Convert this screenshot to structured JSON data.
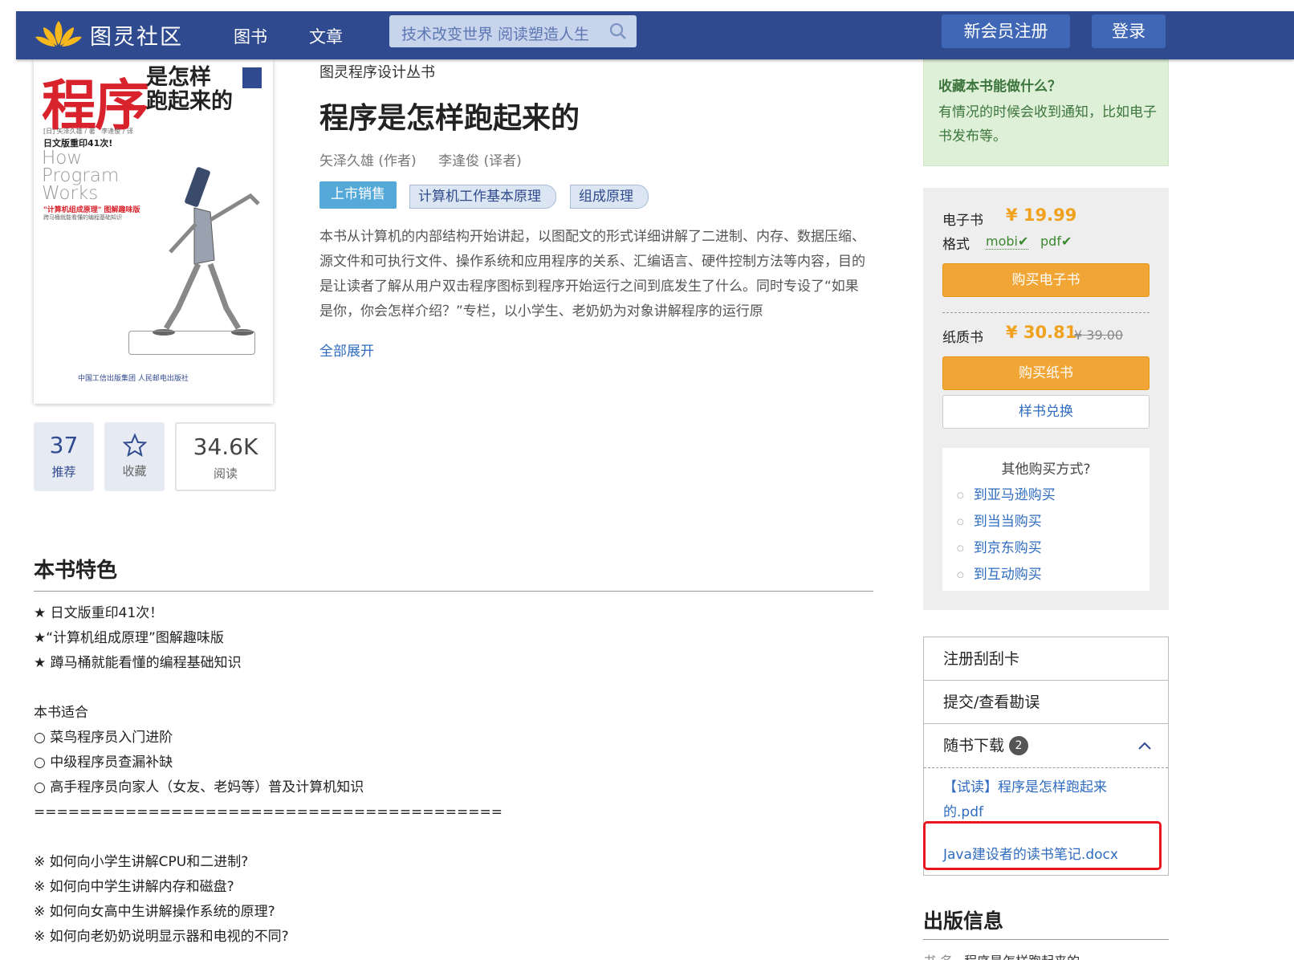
{
  "header": {
    "site_name": "图灵社区",
    "nav": [
      "图书",
      "文章"
    ],
    "search_placeholder": "技术改变世界 阅读塑造人生",
    "register_label": "新会员注册",
    "login_label": "登录",
    "brand_color": "#2f4a8e"
  },
  "cover": {
    "title_big": "程序",
    "title_rest": "是怎样跑起来的",
    "reprint": "日文版重印41次!",
    "english_title": "How Program Works",
    "tagline": "\"计算机组成原理\" 图解趣味版",
    "publisher": "中国工信出版集团  人民邮电出版社"
  },
  "stats": {
    "recommend_count": "37",
    "recommend_label": "推荐",
    "favorite_label": "收藏",
    "read_count": "34.6K",
    "read_label": "阅读"
  },
  "book": {
    "series": "图灵程序设计丛书",
    "title": "程序是怎样跑起来的",
    "author": "矢泽久雄 (作者)",
    "translator": "李逢俊 (译者)",
    "status_tag": "上市销售",
    "tags": [
      "计算机工作基本原理",
      "组成原理"
    ],
    "description": "本书从计算机的内部结构开始讲起，以图配文的形式详细讲解了二进制、内存、数据压缩、源文件和可执行文件、操作系统和应用程序的关系、汇编语言、硬件控制方法等内容，目的是让读者了解从用户双击程序图标到程序开始运行之间到底发生了什么。同时专设了“如果是你，你会怎样介绍？”专栏，以小学生、老奶奶为对象讲解程序的运行原",
    "expand_label": "全部展开"
  },
  "features": {
    "title": "本书特色",
    "lines": [
      "★ 日文版重印41次！",
      "★“计算机组成原理”图解趣味版",
      "★ 蹲马桶就能看懂的编程基础知识",
      "",
      "本书适合",
      "○ 菜鸟程序员入门进阶",
      "○ 中级程序员查漏补缺",
      "○ 高手程序员向家人（女友、老妈等）普及计算机知识",
      "=========================================",
      "",
      "※ 如何向小学生讲解CPU和二进制?",
      "※ 如何向中学生讲解内存和磁盘?",
      "※ 如何向女高中生讲解操作系统的原理?",
      "※ 如何向老奶奶说明显示器和电视的不同?"
    ]
  },
  "sidebar": {
    "favorite_tip_title": "收藏本书能做什么？",
    "favorite_tip_text": "有情况的时候会收到通知，比如电子书发布等。",
    "ebook_label": "电子书",
    "ebook_price": "¥ 19.99",
    "format_label": "格式",
    "formats": [
      "mobi✔",
      "pdf✔"
    ],
    "buy_ebook_label": "购买电子书",
    "paper_label": "纸质书",
    "paper_price": "¥ 30.81",
    "paper_old_price": "¥ 39.00",
    "buy_paper_label": "购买纸书",
    "sample_label": "样书兑换",
    "other_title": "其他购买方式?",
    "other_links": [
      "到亚马逊购买",
      "到当当购买",
      "到京东购买",
      "到互动购买"
    ],
    "menu": [
      "注册刮刮卡",
      "提交/查看勘误",
      "随书下载"
    ],
    "download_count": "2",
    "downloads": [
      "【试读】程序是怎样跑起来的.pdf",
      "Java建设者的读书笔记.docx"
    ],
    "pub_title": "出版信息",
    "pub_row_label": "书    名",
    "pub_row_value": "程序是怎样跑起来的",
    "price_color": "#f0a21e",
    "button_color": "#f0a535",
    "highlight_color": "#e8161e"
  }
}
